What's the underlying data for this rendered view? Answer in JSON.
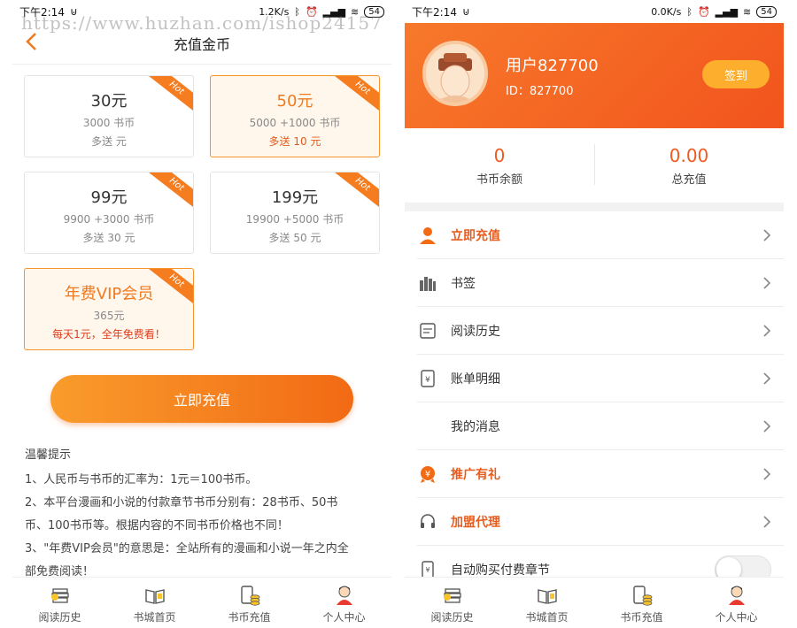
{
  "watermark": "https://www.huzhan.com/ishop24157",
  "left": {
    "status": {
      "time": "下午2:14",
      "speed": "1.2K/s",
      "battery": "54"
    },
    "header": {
      "title": "充值金币"
    },
    "packages": [
      {
        "price": "30元",
        "coins": "3000 书币",
        "bonus": "多送 元",
        "badge": "Hot",
        "selected": false
      },
      {
        "price": "50元",
        "coins": "5000 +1000 书币",
        "bonus": "多送 10 元",
        "badge": "Hot",
        "selected": true
      },
      {
        "price": "99元",
        "coins": "9900 +3000 书币",
        "bonus": "多送 30 元",
        "badge": "Hot",
        "selected": false
      },
      {
        "price": "199元",
        "coins": "19900 +5000 书币",
        "bonus": "多送 50 元",
        "badge": "Hot",
        "selected": false
      }
    ],
    "vip": {
      "title": "年费VIP会员",
      "price": "365元",
      "desc": "每天1元，全年免费看！",
      "badge": "Hot"
    },
    "pay_button": "立即充值",
    "tips": {
      "title": "温馨提示",
      "lines": [
        "1、人民币与书币的汇率为：1元＝100书币。",
        "2、本平台漫画和小说的付款章节书币分别有：28书币、50书",
        "币、100书币等。根据内容的不同书币价格也不同！",
        "3、\"年费VIP会员\"的意思是：全站所有的漫画和小说一年之内全",
        "部免费阅读！"
      ]
    }
  },
  "right": {
    "status": {
      "time": "下午2:14",
      "speed": "0.0K/s",
      "battery": "54"
    },
    "profile": {
      "name": "用户827700",
      "id": "ID：827700",
      "sign_button": "签到"
    },
    "stats": [
      {
        "value": "0",
        "label": "书币余额"
      },
      {
        "value": "0.00",
        "label": "总充值"
      }
    ],
    "menu": [
      {
        "label": "立即充值",
        "icon": "user-icon",
        "highlight": true
      },
      {
        "label": "书签",
        "icon": "bookshelf-icon",
        "highlight": false
      },
      {
        "label": "阅读历史",
        "icon": "history-icon",
        "highlight": false
      },
      {
        "label": "账单明细",
        "icon": "bill-icon",
        "highlight": false
      },
      {
        "label": "我的消息",
        "icon": "",
        "highlight": false
      },
      {
        "label": "推广有礼",
        "icon": "gift-icon",
        "highlight": true
      },
      {
        "label": "加盟代理",
        "icon": "headset-icon",
        "highlight": true
      }
    ],
    "auto_buy": {
      "label": "自动购买付费章节",
      "enabled": false
    }
  },
  "tabbar": [
    {
      "label": "阅读历史",
      "icon": "book-stack-icon"
    },
    {
      "label": "书城首页",
      "icon": "open-book-icon"
    },
    {
      "label": "书币充值",
      "icon": "coin-phone-icon"
    },
    {
      "label": "个人中心",
      "icon": "person-icon"
    }
  ],
  "colors": {
    "accent": "#f26a14",
    "accent_light": "#f99c2c",
    "highlight_text": "#e85c1e"
  }
}
